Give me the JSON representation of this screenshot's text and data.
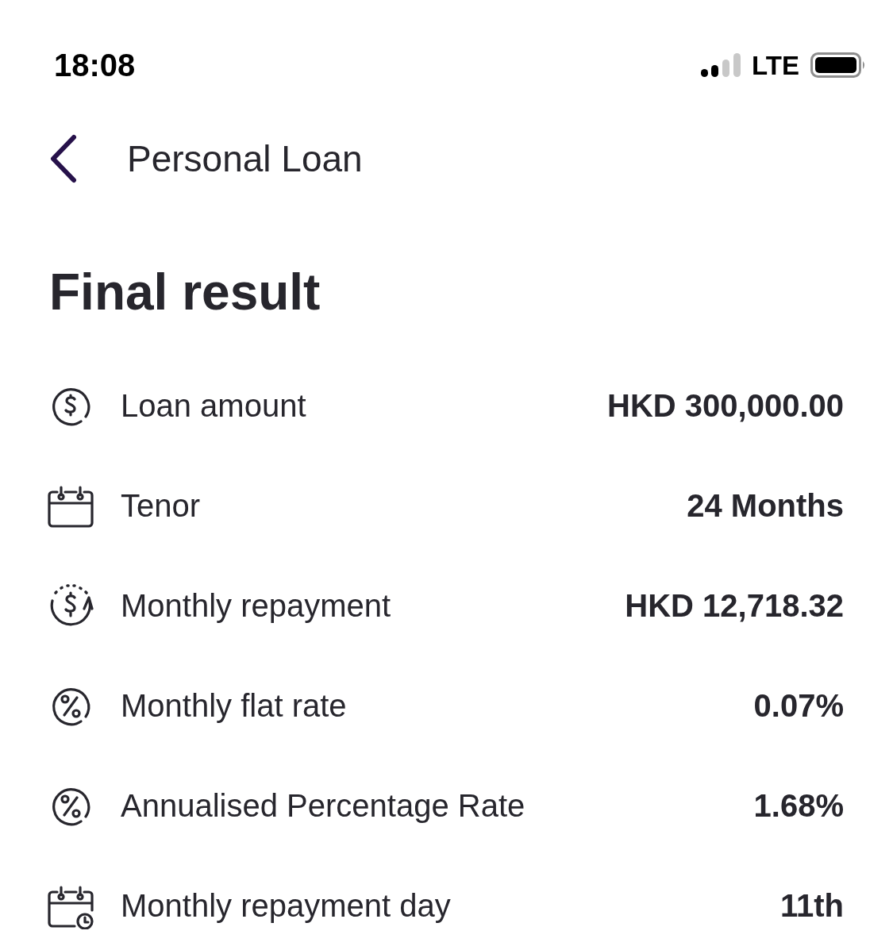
{
  "status_bar": {
    "time": "18:08",
    "network": "LTE"
  },
  "header": {
    "title": "Personal Loan"
  },
  "heading": "Final result",
  "rows": [
    {
      "kind": "money",
      "label": "Loan amount",
      "value": "HKD 300,000.00"
    },
    {
      "kind": "calendar",
      "label": "Tenor",
      "value": "24 Months"
    },
    {
      "kind": "recurring",
      "label": "Monthly repayment",
      "value": "HKD 12,718.32"
    },
    {
      "kind": "percent",
      "label": "Monthly flat rate",
      "value": "0.07%"
    },
    {
      "kind": "percent",
      "label": "Annualised Percentage Rate",
      "value": "1.68%"
    },
    {
      "kind": "schedule",
      "label": "Monthly repayment day",
      "value": "11th"
    }
  ]
}
